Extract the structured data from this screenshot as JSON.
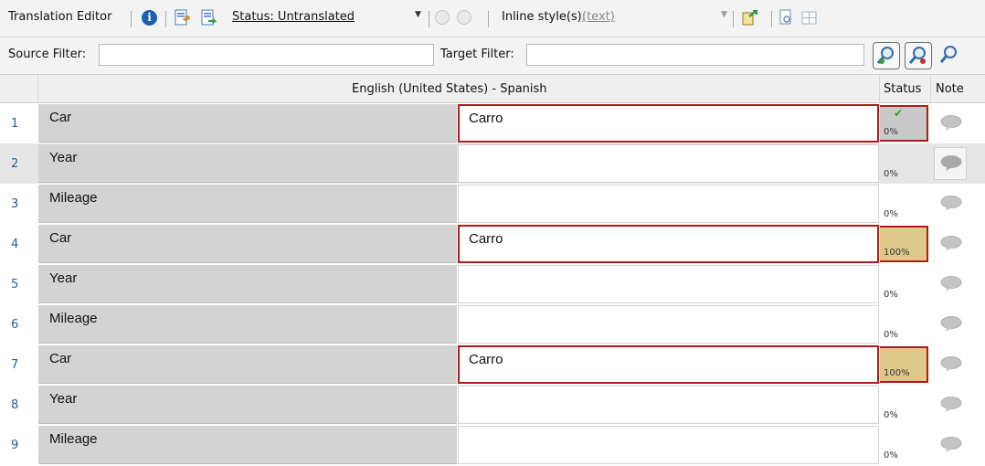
{
  "toolbar": {
    "title": "Translation Editor",
    "status_filter": "Status: Untranslated",
    "inline_styles_label": "Inline style(s):",
    "inline_styles_value": "(text)"
  },
  "filters": {
    "source_label": "Source Filter:",
    "source_value": "",
    "target_label": "Target Filter:",
    "target_value": ""
  },
  "grid": {
    "language_pair": "English (United States) - Spanish",
    "status_header": "Status",
    "note_header": "Note",
    "rows": [
      {
        "num": "1",
        "source": "Car",
        "target": "Carro",
        "status": "0%",
        "approved": true
      },
      {
        "num": "2",
        "source": "Year",
        "target": "",
        "status": "0%",
        "approved": false
      },
      {
        "num": "3",
        "source": "Mileage",
        "target": "",
        "status": "0%",
        "approved": false
      },
      {
        "num": "4",
        "source": "Car",
        "target": "Carro",
        "status": "100%",
        "approved": false
      },
      {
        "num": "5",
        "source": "Year",
        "target": "",
        "status": "0%",
        "approved": false
      },
      {
        "num": "6",
        "source": "Mileage",
        "target": "",
        "status": "0%",
        "approved": false
      },
      {
        "num": "7",
        "source": "Car",
        "target": "Carro",
        "status": "100%",
        "approved": false
      },
      {
        "num": "8",
        "source": "Year",
        "target": "",
        "status": "0%",
        "approved": false
      },
      {
        "num": "9",
        "source": "Mileage",
        "target": "",
        "status": "0%",
        "approved": false
      }
    ]
  },
  "icons": {
    "info": "info-icon",
    "import": "import-icon",
    "export": "export-icon",
    "toggle_on": "toggle-left-icon",
    "toggle_off": "toggle-right-icon",
    "insert": "insert-icon",
    "preview": "preview-icon",
    "grid": "grid-icon",
    "search": "search-icon",
    "note": "note-bubble-icon",
    "check": "check-icon"
  },
  "colors": {
    "selected_border": "#b01a1a",
    "source_bg": "#d3d3d3",
    "full_match_bg": "#dfc98a",
    "row_number": "#2a5a9a"
  }
}
